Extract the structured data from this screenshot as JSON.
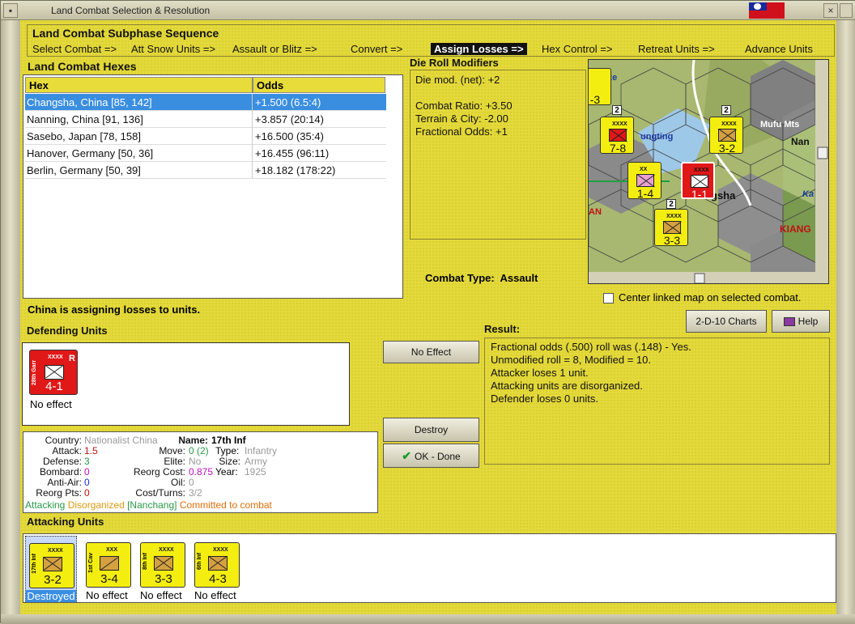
{
  "window": {
    "title": "Land Combat Selection & Resolution"
  },
  "subphase": {
    "header": "Land Combat Subphase Sequence",
    "steps": [
      "Select Combat =>",
      "Att Snow Units =>",
      "Assault or Blitz =>",
      "Convert =>",
      "Assign Losses =>",
      "Hex Control =>",
      "Retreat Units =>",
      "Advance Units"
    ],
    "active_index": 4
  },
  "hexes": {
    "header": "Land Combat Hexes",
    "col_hex": "Hex",
    "col_odds": "Odds",
    "rows": [
      {
        "hex": "Changsha, China [85, 142]",
        "odds": "+1.500 (6.5:4)"
      },
      {
        "hex": "Nanning, China [91, 136]",
        "odds": "+3.857 (20:14)"
      },
      {
        "hex": "Sasebo, Japan [78, 158]",
        "odds": "+16.500 (35:4)"
      },
      {
        "hex": "Hanover, Germany [50, 36]",
        "odds": "+16.455 (96:11)"
      },
      {
        "hex": "Berlin, Germany [50, 39]",
        "odds": "+18.182 (178:22)"
      }
    ],
    "selected_index": 0
  },
  "die_roll": {
    "header": "Die Roll Modifiers",
    "net": "Die mod. (net): +2",
    "combat_ratio": "Combat Ratio: +3.50",
    "terrain": "Terrain & City: -2.00",
    "fractional": "Fractional Odds: +1"
  },
  "combat_type": {
    "label": "Combat Type:",
    "value": "Assault"
  },
  "map": {
    "labels": {
      "yangtze": "tze",
      "tungting": "ungting",
      "mufu": "Mufu Mts",
      "nan": "Nan",
      "changsha": "gsha",
      "ka": "Ka",
      "kiang": "KIANG",
      "an": "AN"
    },
    "counters": [
      {
        "name": "",
        "size": "XXXX",
        "value": "7-8",
        "color": "#f4ee10"
      },
      {
        "name": "",
        "size": "XXXX",
        "value": "3-2",
        "color": "#f4ee10"
      },
      {
        "name": "",
        "size": "XX",
        "value": "1-4",
        "color": "#f4ee10"
      },
      {
        "name": "",
        "size": "XXXX",
        "value": "1-1",
        "color": "#e01818"
      },
      {
        "name": "",
        "size": "XXXX",
        "value": "3-3",
        "color": "#f4ee10"
      },
      {
        "name": "",
        "size": "",
        "value": "-3",
        "color": "#f4ee10"
      }
    ],
    "stack_badges": [
      "2",
      "2",
      "2"
    ]
  },
  "center_map": {
    "label": "Center linked map on selected combat.",
    "checked": false
  },
  "buttons": {
    "charts": "2-D-10 Charts",
    "help": "Help",
    "no_effect": "No Effect",
    "destroy": "Destroy",
    "ok_done": "OK - Done"
  },
  "status": "China is assigning losses to units.",
  "defending": {
    "header": "Defending Units",
    "units": [
      {
        "name": "28th Garr",
        "size": "XXXX",
        "value": "4-1",
        "status": "No effect",
        "badge": "R",
        "color": "#e01818"
      }
    ]
  },
  "result": {
    "header": "Result:",
    "lines": [
      "Fractional odds (.500) roll was (.148)  - Yes.",
      "Unmodified roll = 8, Modified = 10.",
      "Attacker loses 1 unit.",
      "Attacking units are disorganized.",
      "Defender loses 0 units."
    ]
  },
  "unit_info": {
    "country_label": "Country:",
    "country": "Nationalist China",
    "attack_label": "Attack:",
    "attack": "1.5",
    "defense_label": "Defense:",
    "defense": "3",
    "bombard_label": "Bombard:",
    "bombard": "0",
    "antiair_label": "Anti-Air:",
    "antiair": "0",
    "reorgpts_label": "Reorg Pts:",
    "reorgpts": "0",
    "name_label": "Name:",
    "name": "17th Inf",
    "move_label": "Move:",
    "move": "0 (2)",
    "type_label": "Type:",
    "type": "Infantry",
    "elite_label": "Elite:",
    "elite": "No",
    "size_label": "Size:",
    "size": "Army",
    "reorgcost_label": "Reorg Cost:",
    "reorgcost": "0.875",
    "year_label": "Year:",
    "year": "1925",
    "oil_label": "Oil:",
    "oil": "0",
    "costturns_label": "Cost/Turns:",
    "costturns": "3/2",
    "status_attacking": "Attacking",
    "status_disorganized": "Disorganized",
    "status_nanchang": "[Nanchang]",
    "status_committed": "Committed to combat",
    "colors": {
      "attacking": "#2a9a4a",
      "disorganized": "#e09a10",
      "nanchang": "#2a9a4a",
      "committed": "#e0700a",
      "attack": "#c01010",
      "defense": "#2a9a4a",
      "bombard": "#c010c0",
      "antiair": "#1a2ae0",
      "reorgpts": "#c01010",
      "reorgcost": "#c010c0"
    }
  },
  "attacking": {
    "header": "Attacking Units",
    "units": [
      {
        "name": "17th Inf",
        "size": "XXXX",
        "value": "3-2",
        "status": "Destroyed",
        "selected": true
      },
      {
        "name": "1st Cav",
        "size": "XXX",
        "value": "3-4",
        "status": "No effect",
        "selected": false
      },
      {
        "name": "8th Inf",
        "size": "XXXX",
        "value": "3-3",
        "status": "No effect",
        "selected": false
      },
      {
        "name": "6th Inf",
        "size": "XXXX",
        "value": "4-3",
        "status": "No effect",
        "selected": false
      }
    ]
  }
}
